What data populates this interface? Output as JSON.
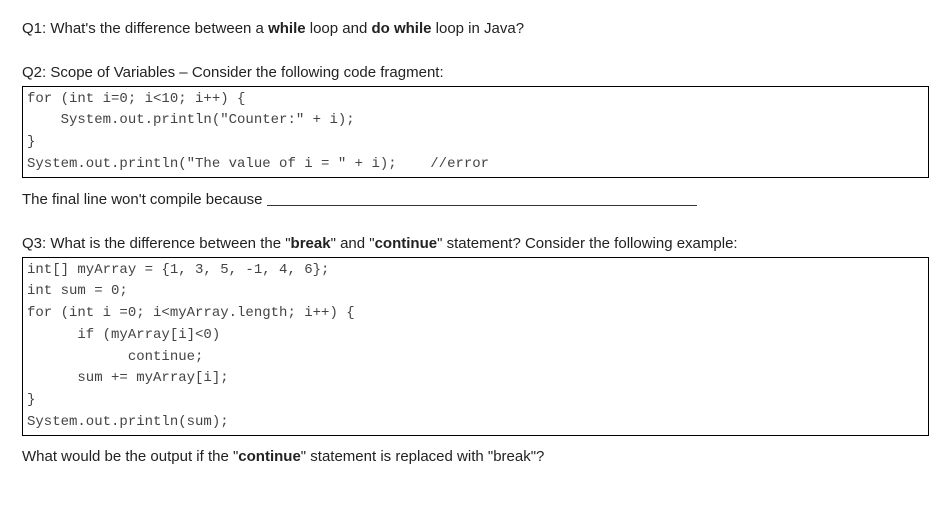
{
  "q1": {
    "pre": "Q1: What's the difference between a ",
    "b1": "while",
    "mid": " loop and ",
    "b2": "do while",
    "post": " loop in Java?"
  },
  "q2": {
    "heading": "Q2: Scope of Variables – Consider the following code fragment:",
    "code": "for (int i=0; i<10; i++) {\n    System.out.println(\"Counter:\" + i);\n}\nSystem.out.println(\"The value of i = \" + i);    //error",
    "tail": "The final line won't compile because "
  },
  "q3": {
    "pre": "Q3: What is the difference between the \"",
    "b1": "break",
    "mid": "\" and \"",
    "b2": "continue",
    "post": "\" statement? Consider the following example:",
    "code": "int[] myArray = {1, 3, 5, -1, 4, 6};\nint sum = 0;\nfor (int i =0; i<myArray.length; i++) {\n      if (myArray[i]<0)\n            continue;\n      sum += myArray[i];\n}\nSystem.out.println(sum);",
    "tail_pre": "What would be the output if the \"",
    "tail_b": "continue",
    "tail_post": "\" statement is replaced with \"break\"?"
  }
}
